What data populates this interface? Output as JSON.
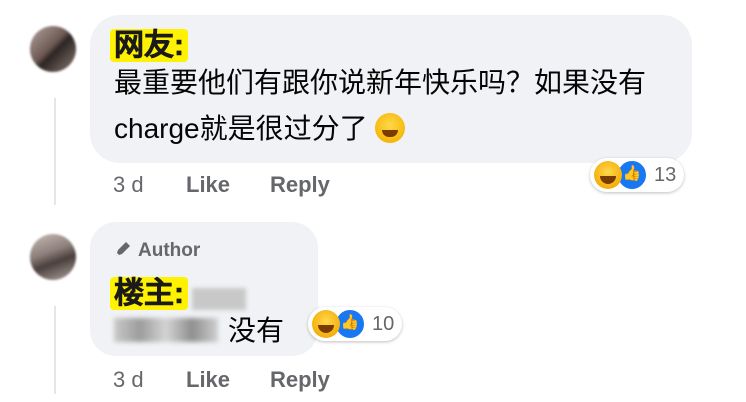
{
  "comment1": {
    "name": "网友:",
    "text": "最重要他们有跟你说新年快乐吗？如果没有 charge就是很过分了",
    "time": "3 d",
    "like_label": "Like",
    "reply_label": "Reply",
    "reaction_count": "13"
  },
  "comment2": {
    "badge": "Author",
    "name": "楼主:",
    "text": "没有",
    "time": "3 d",
    "like_label": "Like",
    "reply_label": "Reply",
    "reaction_count": "10"
  },
  "colors": {
    "bubble": "#f0f2f5",
    "highlight": "#fff200",
    "meta": "#65676b",
    "like_blue": "#1877f2"
  },
  "icons": [
    "haha-emoji-icon",
    "like-reaction-icon",
    "author-pen-icon"
  ]
}
